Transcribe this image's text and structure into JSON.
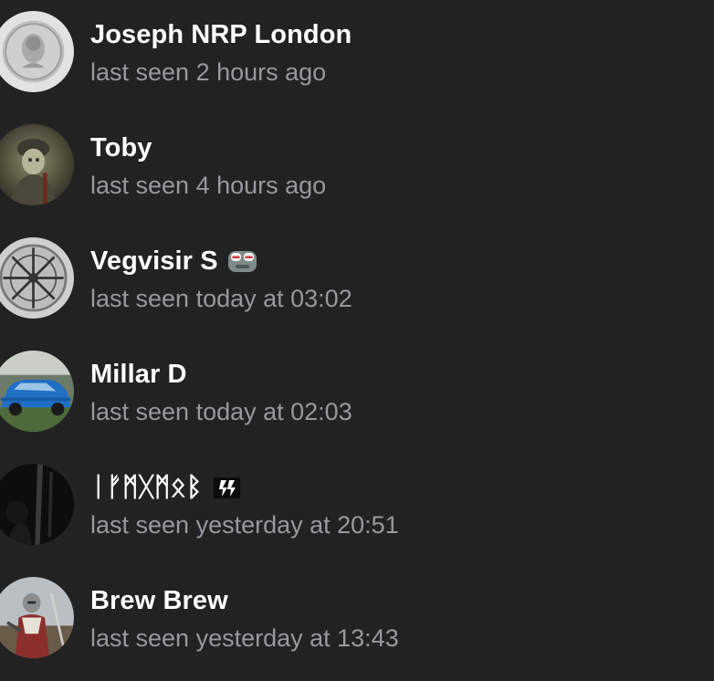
{
  "contacts": [
    {
      "name": "Joseph NRP London",
      "status": "last seen 2 hours ago",
      "avatar_icon": "coin-avatar-icon"
    },
    {
      "name": "Toby",
      "status": "last seen 4 hours ago",
      "avatar_icon": "soldier-avatar-icon"
    },
    {
      "name": "Vegvisir S",
      "status": "last seen today at 03:02",
      "avatar_icon": "vegvisir-avatar-icon",
      "badge_icon": "no-entry-emoji-icon"
    },
    {
      "name": "Millar D",
      "status": "last seen today at 02:03",
      "avatar_icon": "car-avatar-icon"
    },
    {
      "name": "ᛁᚠᛗᚷᛗᛟᛒ",
      "status": "last seen yesterday at 20:51",
      "avatar_icon": "dark-avatar-icon",
      "badge_icon": "flag-emoji-icon"
    },
    {
      "name": "Brew Brew",
      "status": "last seen yesterday at 13:43",
      "avatar_icon": "knight-avatar-icon"
    }
  ],
  "colors": {
    "background": "#222223",
    "name": "#ffffff",
    "status": "#98989d"
  }
}
